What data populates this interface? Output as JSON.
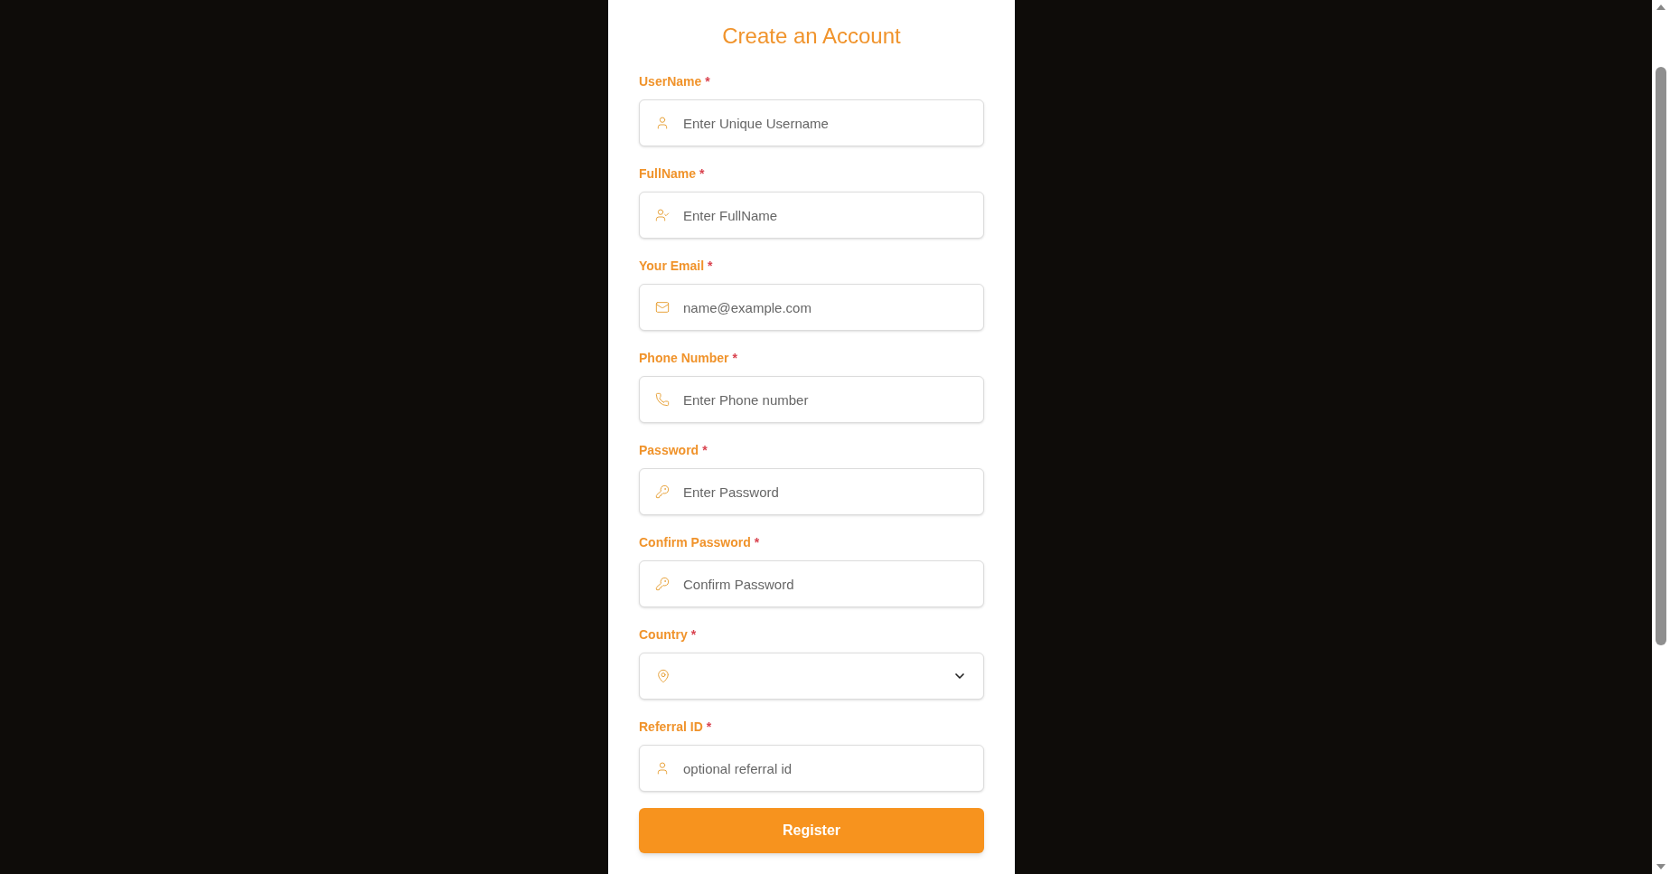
{
  "form": {
    "title": "Create an Account",
    "fields": [
      {
        "label": "UserName",
        "required": "*",
        "kind": "input",
        "placeholder": "Enter Unique Username"
      },
      {
        "label": "FullName",
        "required": "*",
        "kind": "input",
        "placeholder": "Enter FullName"
      },
      {
        "label": "Your Email",
        "required": "*",
        "kind": "input",
        "placeholder": "name@example.com"
      },
      {
        "label": "Phone Number",
        "required": "*",
        "kind": "input",
        "placeholder": "Enter Phone number"
      },
      {
        "label": "Password",
        "required": "*",
        "kind": "input",
        "placeholder": "Enter Password"
      },
      {
        "label": "Confirm Password",
        "required": "*",
        "kind": "input",
        "placeholder": "Confirm Password"
      },
      {
        "label": "Country",
        "required": "*",
        "kind": "select"
      },
      {
        "label": "Referral ID",
        "required": "*",
        "kind": "input",
        "placeholder": "optional referral id"
      }
    ],
    "submit": "Register"
  }
}
